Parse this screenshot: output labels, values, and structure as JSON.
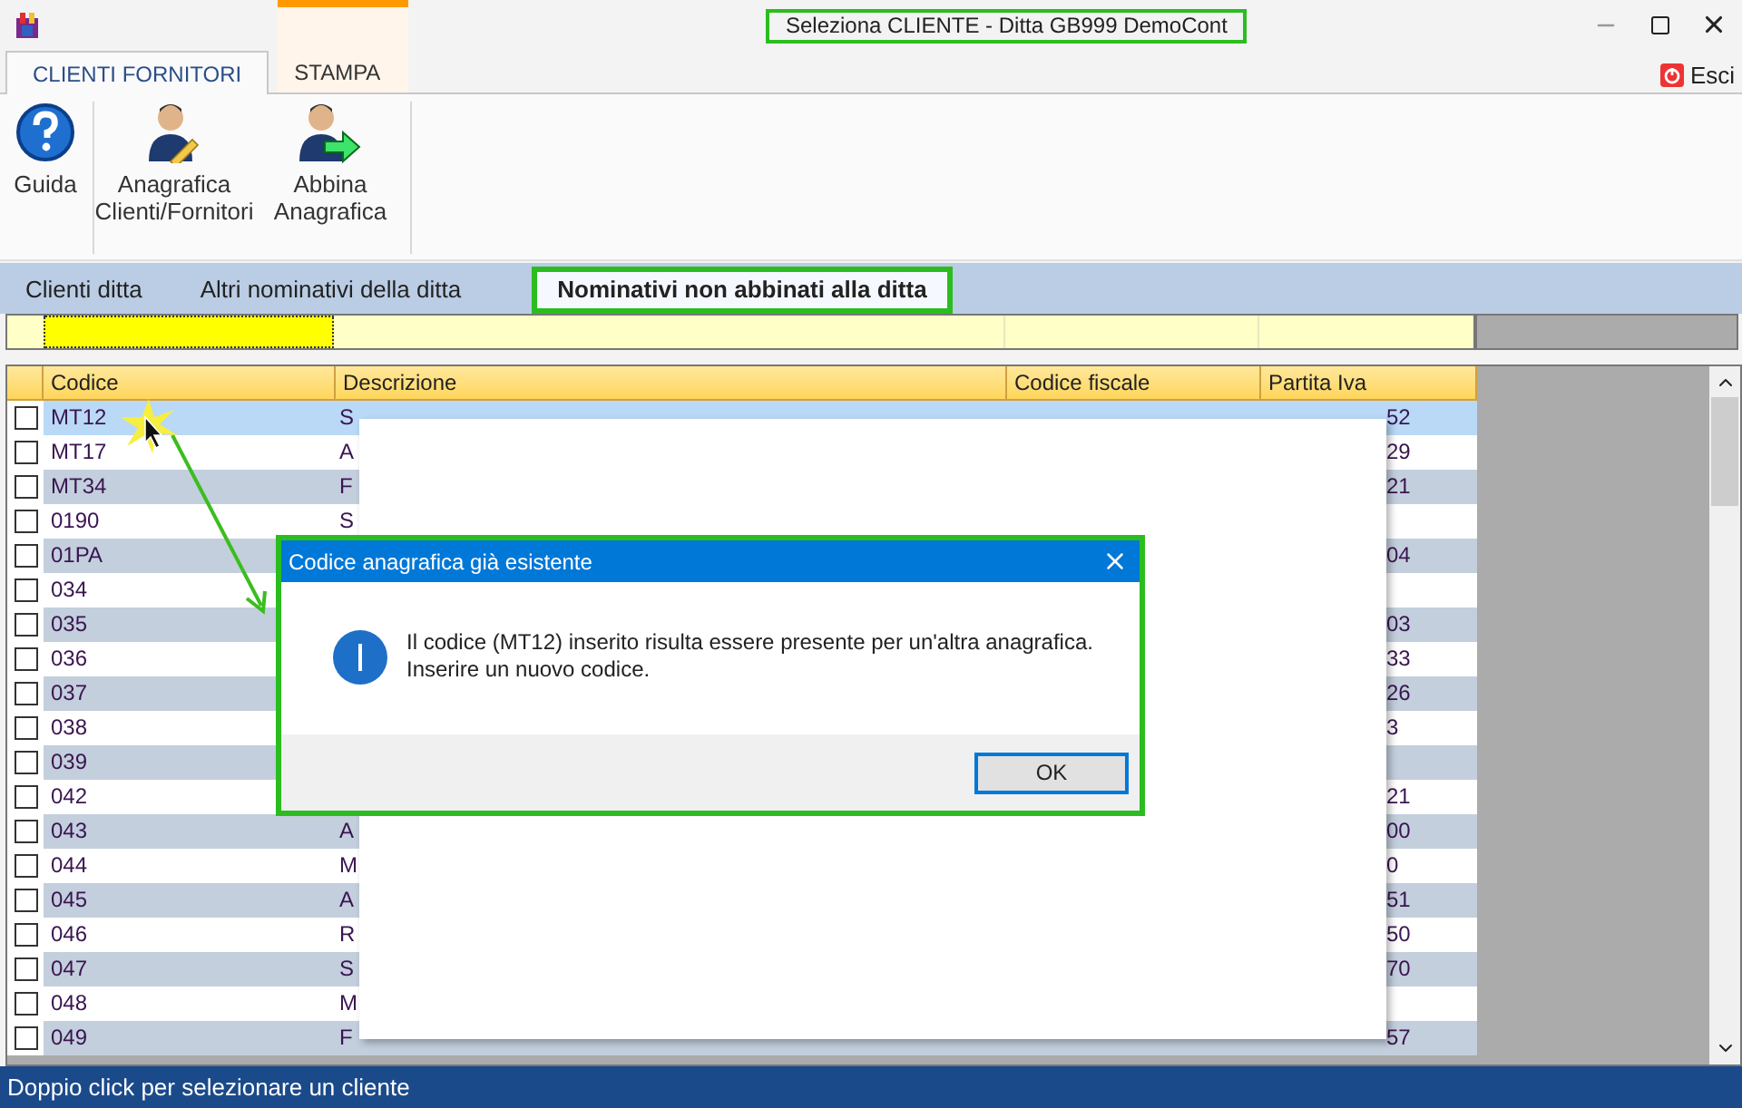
{
  "window": {
    "title": "Seleziona CLIENTE  - Ditta GB999 DemoCont",
    "highlighted": true
  },
  "ribbon_tabs": [
    {
      "label": "CLIENTI FORNITORI",
      "selected": true,
      "kind": "normal"
    },
    {
      "label": "STAMPA",
      "selected": false,
      "kind": "context"
    }
  ],
  "exit_button": "Esci",
  "ribbon_buttons": [
    {
      "label": "Guida",
      "kind": "help"
    },
    {
      "label": "Anagrafica Clienti/Fornitori",
      "kind": "edit-person"
    },
    {
      "label": "Abbina Anagrafica",
      "kind": "link-person"
    }
  ],
  "view_tabs": [
    {
      "label": "Clienti ditta",
      "selected": false
    },
    {
      "label": "Altri nominativi della ditta",
      "selected": false
    },
    {
      "label": "Nominativi non abbinati alla ditta",
      "selected": true
    }
  ],
  "table": {
    "columns": [
      "Codice",
      "Descrizione",
      "Codice fiscale",
      "Partita Iva"
    ],
    "rows": [
      {
        "codice": "MT12",
        "descrizione": "S",
        "partita_iva": "52",
        "checked": false,
        "selected": true
      },
      {
        "codice": "MT17",
        "descrizione": "A",
        "partita_iva": "29",
        "checked": false,
        "selected": false
      },
      {
        "codice": "MT34",
        "descrizione": "F",
        "partita_iva": "21",
        "checked": false,
        "selected": false
      },
      {
        "codice": "0190",
        "descrizione": "S",
        "checked": false,
        "selected": false
      },
      {
        "codice": "01PA",
        "partita_iva": "04",
        "checked": false,
        "selected": false
      },
      {
        "codice": "034",
        "checked": false,
        "selected": false
      },
      {
        "codice": "035",
        "partita_iva": "03",
        "checked": false,
        "selected": false
      },
      {
        "codice": "036",
        "partita_iva": "33",
        "checked": false,
        "selected": false
      },
      {
        "codice": "037",
        "partita_iva": "26",
        "checked": false,
        "selected": false
      },
      {
        "codice": "038",
        "partita_iva": "3",
        "checked": false,
        "selected": false
      },
      {
        "codice": "039",
        "checked": false,
        "selected": false
      },
      {
        "codice": "042",
        "partita_iva": "21",
        "checked": false,
        "selected": false
      },
      {
        "codice": "043",
        "descrizione": "A",
        "partita_iva": "00",
        "checked": false,
        "selected": false
      },
      {
        "codice": "044",
        "descrizione": "M",
        "partita_iva": "0",
        "checked": false,
        "selected": false
      },
      {
        "codice": "045",
        "descrizione": "A",
        "partita_iva": "51",
        "checked": false,
        "selected": false
      },
      {
        "codice": "046",
        "descrizione": "R",
        "partita_iva": "50",
        "checked": false,
        "selected": false
      },
      {
        "codice": "047",
        "descrizione": "S",
        "partita_iva": "70",
        "checked": false,
        "selected": false
      },
      {
        "codice": "048",
        "descrizione": "M",
        "checked": false,
        "selected": false
      },
      {
        "codice": "049",
        "descrizione": "F",
        "partita_iva": "57",
        "checked": false,
        "selected": false
      }
    ]
  },
  "dialog": {
    "title": "Codice anagrafica già esistente",
    "lines": [
      "Il codice (MT12) inserito risulta essere presente per un'altra anagrafica.",
      "Inserire un nuovo codice."
    ],
    "button": "OK"
  },
  "status_bar": "Doppio click per selezionare un cliente"
}
